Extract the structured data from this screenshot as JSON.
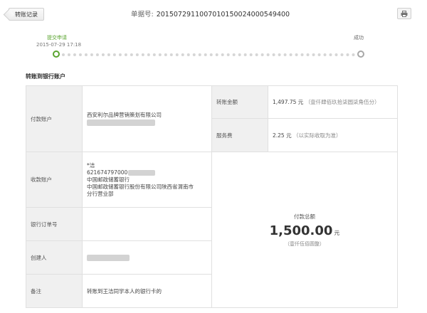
{
  "header": {
    "back_label": "转账记录",
    "doc_no_label": "单据号:",
    "doc_no": "2015072911007010150024000549400"
  },
  "progress": {
    "start_label": "提交申请",
    "start_time": "2015-07-29 17:18",
    "end_label": "成功"
  },
  "section_title": "转账到银行账户",
  "payer": {
    "label": "付款账户",
    "company": "西安利尔品牌营销策划有限公司"
  },
  "payee": {
    "label": "收款账户",
    "name": "*洁",
    "account": "621674797000",
    "bank": "中国邮政储蓄银行",
    "branch_line1": "中国邮政储蓄银行股份有限公司陕西省渭南市",
    "branch_line2": "分行营业部"
  },
  "bank_order": {
    "label": "银行订单号",
    "value": ""
  },
  "creator": {
    "label": "创建人"
  },
  "remark": {
    "label": "备注",
    "value": "转账到王洁同学本人的银行卡的"
  },
  "amount": {
    "label": "转账金额",
    "value": "1,497.75 元",
    "upper": "（壹仟肆佰玖拾柒圆柒角伍分）"
  },
  "fee": {
    "label": "服务费",
    "value": "2.25 元",
    "note": "（以实际收取为准）"
  },
  "total": {
    "label": "付款总额",
    "value": "1,500.00",
    "unit": "元",
    "upper": "（壹仟伍佰圆整）"
  }
}
